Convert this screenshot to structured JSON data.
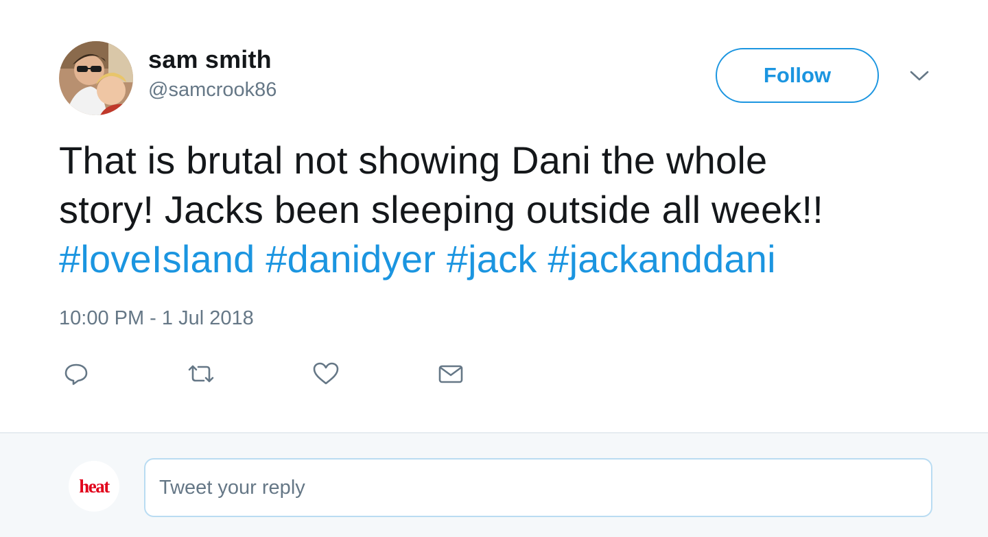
{
  "author": {
    "name": "sam smith",
    "handle": "@samcrook86"
  },
  "follow_button": {
    "label": "Follow"
  },
  "more_menu": {
    "icon": "chevron-down-icon"
  },
  "tweet": {
    "text_line_1": "That is brutal not showing Dani the whole",
    "text_line_2": "story! Jacks been sleeping outside all week!!",
    "hashtags": [
      "#loveIsland",
      "#danidyer",
      "#jack",
      "#jackanddani"
    ],
    "timestamp": "10:00 PM - 1 Jul 2018"
  },
  "actions": [
    {
      "name": "reply",
      "icon": "reply-icon"
    },
    {
      "name": "retweet",
      "icon": "retweet-icon"
    },
    {
      "name": "like",
      "icon": "heart-icon"
    },
    {
      "name": "message",
      "icon": "envelope-icon"
    }
  ],
  "reply_box": {
    "brand_logo": "heat",
    "placeholder": "Tweet your reply"
  },
  "colors": {
    "link": "#1b95e0",
    "text": "#14171a",
    "secondary": "#657786",
    "brand_red": "#e1001a",
    "reply_bg": "#f5f8fa"
  }
}
